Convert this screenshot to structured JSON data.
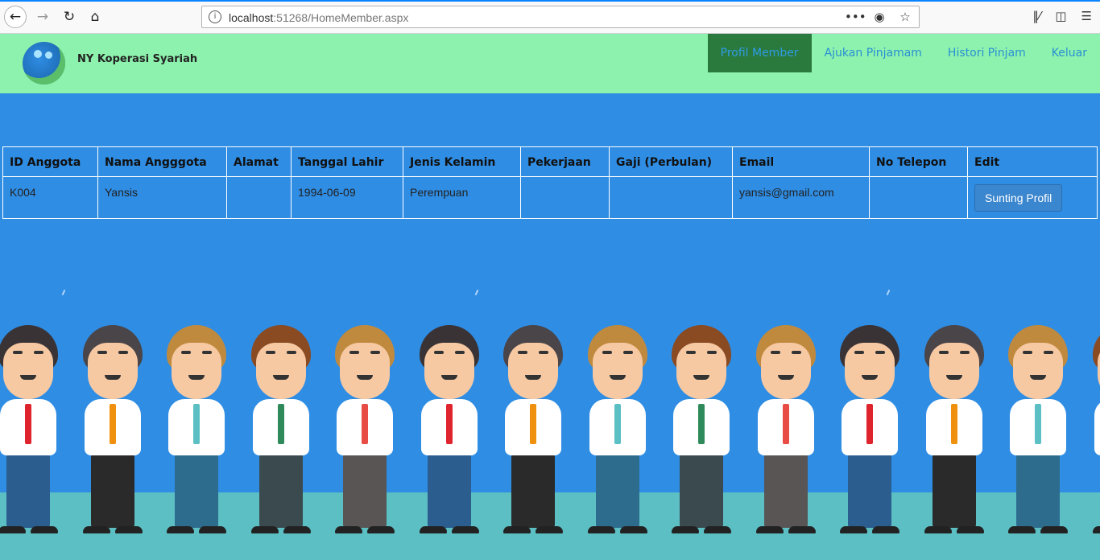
{
  "browser": {
    "url_host": "localhost",
    "url_rest": ":51268/HomeMember.aspx",
    "more_label": "•••",
    "icons": [
      "back-icon",
      "forward-icon",
      "reload-icon",
      "home-icon",
      "info-icon",
      "more-icon",
      "pocket-icon",
      "bookmark-star-icon",
      "library-icon",
      "sidebar-icon",
      "menu-icon"
    ]
  },
  "header": {
    "brand": "NY Koperasi Syariah",
    "nav": [
      {
        "label": "Profil Member",
        "active": true
      },
      {
        "label": "Ajukan Pinjamam",
        "active": false
      },
      {
        "label": "Histori Pinjam",
        "active": false
      },
      {
        "label": "Keluar",
        "active": false
      }
    ]
  },
  "table": {
    "headers": [
      "ID Anggota",
      "Nama Angggota",
      "Alamat",
      "Tanggal Lahir",
      "Jenis Kelamin",
      "Pekerjaan",
      "Gaji (Perbulan)",
      "Email",
      "No Telepon",
      "Edit"
    ],
    "rows": [
      [
        "K004",
        "Yansis",
        "",
        "1994-06-09",
        "Perempuan",
        "",
        "",
        "yansis@gmail.com",
        ""
      ]
    ],
    "edit_button": "Sunting Profil"
  },
  "colors": {
    "background": "#2f8de4",
    "header_bg": "#8df2ad",
    "nav_active_bg": "#2a7a3e",
    "nav_text": "#2a8fd4",
    "ground": "#5bbfc4"
  }
}
